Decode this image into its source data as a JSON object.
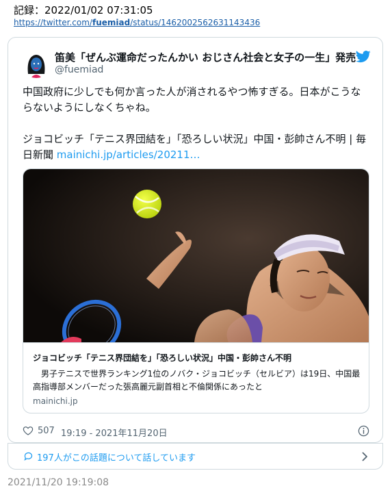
{
  "header": {
    "record_label": "記録：2022/01/02 07:31:05",
    "url_prefix": "https://twitter.com/",
    "url_user": "fuemiad",
    "url_suffix": "/status/1462002562631143436"
  },
  "tweet": {
    "author_name": "笛美「ぜんぶ運命だったんかい おじさん社会と女子の一生」発売中",
    "author_handle": "@fuemiad",
    "text_line1": "中国政府に少しでも何か言った人が消されるやつ怖すぎる。日本がこうならないようにしなくちゃね。",
    "text_line2": "ジョコビッチ「テニス界団結を」「恐ろしい状況」中国・彭帥さん不明 | 毎日新聞 ",
    "text_link": "mainichi.jp/articles/20211…",
    "like_count": "507",
    "timestamp": "19:19 - 2021年11月20日"
  },
  "link_card": {
    "title": "ジョコビッチ「テニス界団結を」「恐ろしい状況」中国・彭帥さん不明",
    "description": "　男子テニスで世界ランキング1位のノバク・ジョコビッチ（セルビア）は19日、中国最高指導部メンバーだった張高麗元副首相と不倫関係にあったと",
    "domain": "mainichi.jp"
  },
  "footer": {
    "conversation_text": "197人がこの話題について話しています"
  },
  "saved_at": "2021/11/20 19:19:08",
  "colors": {
    "link_blue": "#1d9bf0",
    "text": "#0f1419",
    "muted": "#536471",
    "border": "#cfd9de"
  },
  "icons": [
    "twitter-bird-icon",
    "heart-icon",
    "info-icon",
    "comment-icon",
    "chevron-right-icon"
  ]
}
